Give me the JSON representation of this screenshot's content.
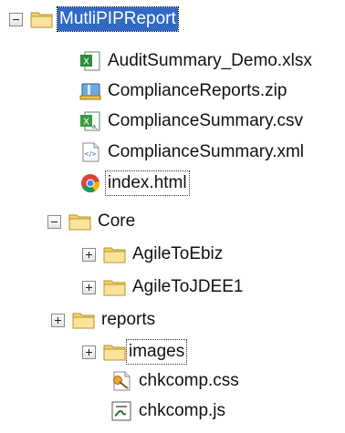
{
  "tree": {
    "root": {
      "label": "MutliPIPReport",
      "state": "expanded",
      "selected": true
    },
    "files": [
      {
        "label": "AuditSummary_Demo.xlsx",
        "icon": "excel-file-icon"
      },
      {
        "label": "ComplianceReports.zip",
        "icon": "zip-archive-icon"
      },
      {
        "label": "ComplianceSummary.csv",
        "icon": "excel-csv-file-icon"
      },
      {
        "label": "ComplianceSummary.xml",
        "icon": "xml-file-icon"
      },
      {
        "label": "index.html",
        "icon": "chrome-html-file-icon"
      }
    ],
    "core": {
      "label": "Core",
      "state": "expanded",
      "children": [
        {
          "label": "AgileToEbiz",
          "state": "collapsed"
        },
        {
          "label": "AgileToJDEE1",
          "state": "collapsed"
        }
      ]
    },
    "reports": {
      "label": "reports",
      "state": "collapsed",
      "children": [
        {
          "label": "images",
          "state": "collapsed"
        },
        {
          "label": "chkcomp.css",
          "icon": "css-file-icon"
        },
        {
          "label": "chkcomp.js",
          "icon": "js-script-file-icon"
        }
      ]
    }
  },
  "colors": {
    "selection": "#316ac5",
    "folder": "#f5d36b"
  }
}
